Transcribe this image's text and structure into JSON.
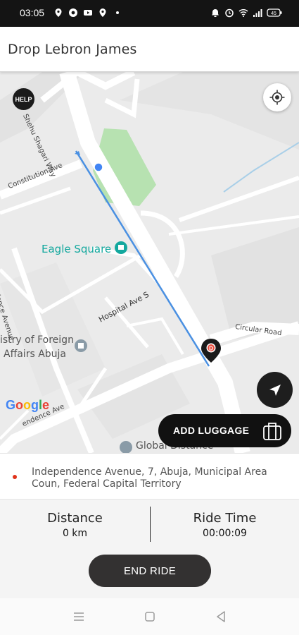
{
  "status_bar": {
    "time": "03:05",
    "left_icons": [
      "location-icon",
      "chrome-icon",
      "youtube-icon",
      "location-icon",
      "dot-icon"
    ],
    "right_icons": [
      "alarm-icon",
      "clock-icon",
      "wifi-icon",
      "signal-icon",
      "battery-icon"
    ],
    "battery": "45"
  },
  "header": {
    "title": "Drop Lebron James"
  },
  "map": {
    "help_label": "HELP",
    "labels": {
      "road_shehu": "Shehu Shagari Way",
      "road_constitution": "Constitution Ave",
      "poi_eagle": "Eagle Square",
      "road_hospital": "Hospital Ave S",
      "road_circular": "Circular Road",
      "road_independence_left": "ndence Avenue",
      "poi_ministry_line1": "istry of Foreign",
      "poi_ministry_line2": "Affairs Abuja",
      "road_independence_bottom": "endence Ave",
      "poi_global": "Global Distance"
    },
    "destination_marker": "D",
    "google": [
      "G",
      "o",
      "o",
      "g",
      "l",
      "e"
    ],
    "google_colors": [
      "#4285F4",
      "#EA4335",
      "#FBBC05",
      "#4285F4",
      "#34A853",
      "#EA4335"
    ],
    "route_color": "#4a90e2",
    "park_color": "#b7e2b1"
  },
  "luggage_button": {
    "label": "ADD LUGGAGE"
  },
  "address": {
    "text": "Independence Avenue, 7, Abuja, Municipal Area Coun, Federal Capital Territory"
  },
  "stats": {
    "distance_title": "Distance",
    "distance_value": "0 km",
    "ride_time_title": "Ride Time",
    "ride_time_value": "00:00:09"
  },
  "end_ride_button": {
    "label": "END RIDE"
  },
  "nav_bar": {
    "items": [
      "recents-icon",
      "home-icon",
      "back-icon"
    ]
  }
}
